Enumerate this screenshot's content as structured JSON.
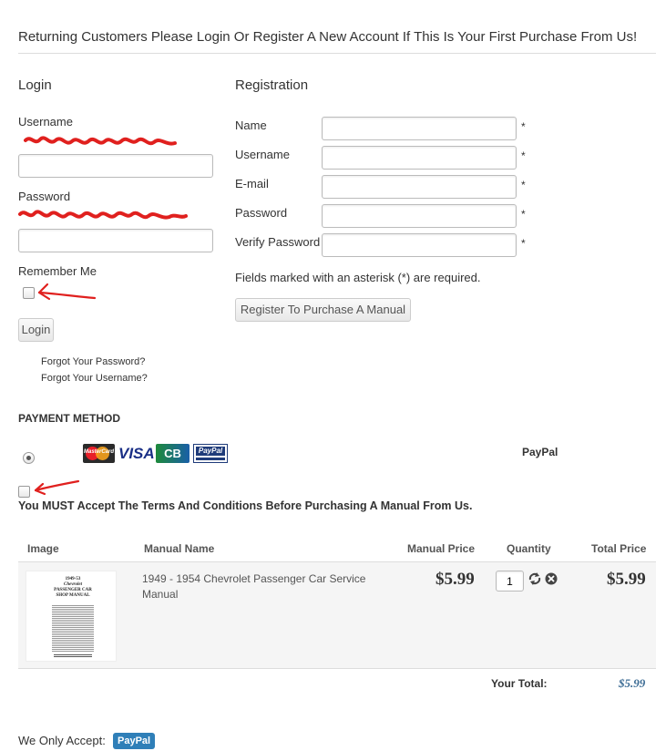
{
  "page_heading": "Returning Customers Please Login Or Register A New Account If This Is Your First Purchase From Us!",
  "login": {
    "title": "Login",
    "username_label": "Username",
    "username_value": "",
    "password_label": "Password",
    "password_value": "",
    "remember_label": "Remember Me",
    "remember_checked": false,
    "login_button": "Login",
    "forgot_password": "Forgot Your Password?",
    "forgot_username": "Forgot Your Username?"
  },
  "registration": {
    "title": "Registration",
    "fields": [
      {
        "label": "Name",
        "value": "",
        "required": "*"
      },
      {
        "label": "Username",
        "value": "",
        "required": "*"
      },
      {
        "label": "E-mail",
        "value": "",
        "required": "*"
      },
      {
        "label": "Password",
        "value": "",
        "required": "*"
      },
      {
        "label": "Verify Password",
        "value": "",
        "required": "*"
      }
    ],
    "required_note": "Fields marked with an asterisk (*) are required.",
    "register_button": "Register To Purchase A Manual"
  },
  "payment": {
    "title": "PAYMENT METHOD",
    "method_selected": true,
    "cards": [
      "MasterCard",
      "VISA",
      "CB",
      "PayPal"
    ],
    "method_name": "PayPal"
  },
  "terms": {
    "checked": false,
    "text": "You MUST Accept The Terms And Conditions Before Purchasing A Manual From Us."
  },
  "cart": {
    "headers": {
      "image": "Image",
      "name": "Manual Name",
      "price": "Manual Price",
      "quantity": "Quantity",
      "total": "Total Price"
    },
    "items": [
      {
        "thumb_lines": [
          "1949-53",
          "Chevrolet",
          "PASSENGER CAR",
          "SHOP MANUAL"
        ],
        "name": "1949 - 1954 Chevrolet Passenger Car Service Manual",
        "price": "$5.99",
        "quantity": "1",
        "total": "$5.99"
      }
    ],
    "total_label": "Your Total:",
    "total_value": "$5.99"
  },
  "accept": {
    "label": "We Only Accept:",
    "badge": "PayPal"
  },
  "colors": {
    "annotation_red": "#e0201e",
    "total_blue": "#3f6e96",
    "badge_blue": "#2f7fb8"
  }
}
